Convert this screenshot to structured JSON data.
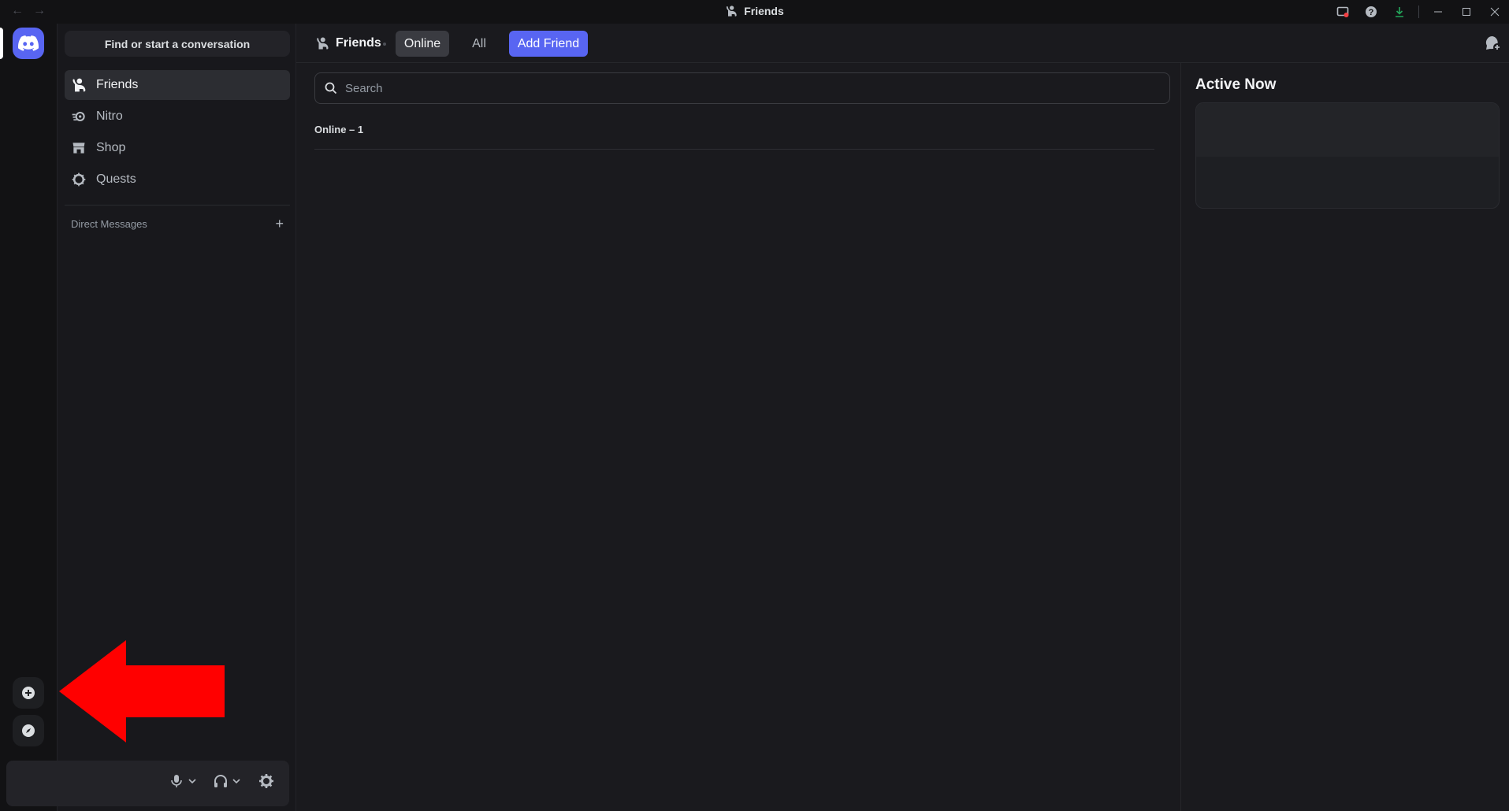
{
  "window": {
    "title": "Friends",
    "back_icon": "arrow-left-icon",
    "forward_icon": "arrow-right-icon",
    "controls": [
      "inbox-icon",
      "help-icon",
      "download-icon",
      "minimize-icon",
      "maximize-icon",
      "close-icon"
    ]
  },
  "sidebar": {
    "search_label": "Find or start a conversation",
    "items": [
      {
        "label": "Friends",
        "icon": "friends-icon"
      },
      {
        "label": "Nitro",
        "icon": "nitro-icon"
      },
      {
        "label": "Shop",
        "icon": "shop-icon"
      },
      {
        "label": "Quests",
        "icon": "quests-icon"
      }
    ],
    "dm_header": "Direct Messages",
    "dm_add": "+"
  },
  "header": {
    "title": "Friends",
    "tabs": [
      {
        "label": "Online"
      },
      {
        "label": "All"
      },
      {
        "label": "Add Friend"
      }
    ]
  },
  "main": {
    "search_placeholder": "Search",
    "online_count": "Online – 1"
  },
  "active_now": {
    "title": "Active Now"
  },
  "colors": {
    "brand": "#5865f2",
    "annotation_arrow": "#ff0000",
    "download_green": "#23a55a"
  }
}
